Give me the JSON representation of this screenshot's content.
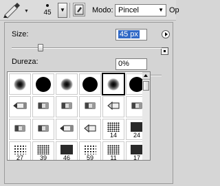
{
  "options_bar": {
    "tool_icon": "brush-tool-icon",
    "brush_size_value": "45",
    "picker_arrow": "chevron-down-icon",
    "toggle_icon": "brush-panel-toggle-icon",
    "mode_label": "Modo:",
    "mode_value": "Pincel",
    "opacity_label_partial": "Op"
  },
  "brush_panel": {
    "size_label": "Size:",
    "size_value": "45 px",
    "size_fraction": 0.18,
    "hardness_label": "Dureza:",
    "hardness_value": "0%",
    "hardness_fraction": 0.0,
    "menu_icon": "panel-menu-arrow-icon",
    "new_preset_icon": "new-preset-icon"
  },
  "presets": [
    {
      "kind": "round-soft",
      "label": ""
    },
    {
      "kind": "round-hard",
      "label": ""
    },
    {
      "kind": "round-soft",
      "label": ""
    },
    {
      "kind": "round-hard",
      "label": ""
    },
    {
      "kind": "round-soft",
      "label": "",
      "selected": true
    },
    {
      "kind": "round-hard",
      "label": ""
    },
    {
      "kind": "pencil",
      "label": ""
    },
    {
      "kind": "marker",
      "label": ""
    },
    {
      "kind": "marker",
      "label": ""
    },
    {
      "kind": "marker",
      "label": ""
    },
    {
      "kind": "airbrush",
      "label": ""
    },
    {
      "kind": "marker",
      "label": ""
    },
    {
      "kind": "marker",
      "label": ""
    },
    {
      "kind": "marker",
      "label": ""
    },
    {
      "kind": "pencil",
      "label": ""
    },
    {
      "kind": "airbrush",
      "label": ""
    },
    {
      "kind": "scatter",
      "label": "14"
    },
    {
      "kind": "scatter",
      "label": "24"
    },
    {
      "kind": "scatter",
      "label": "27"
    },
    {
      "kind": "scatter",
      "label": "39"
    },
    {
      "kind": "scatter",
      "label": "46"
    },
    {
      "kind": "scatter",
      "label": "59"
    },
    {
      "kind": "scatter",
      "label": "11"
    },
    {
      "kind": "scatter",
      "label": "17"
    }
  ],
  "colors": {
    "selection": "#3169c6",
    "panel_bg": "#d4d4d4"
  }
}
